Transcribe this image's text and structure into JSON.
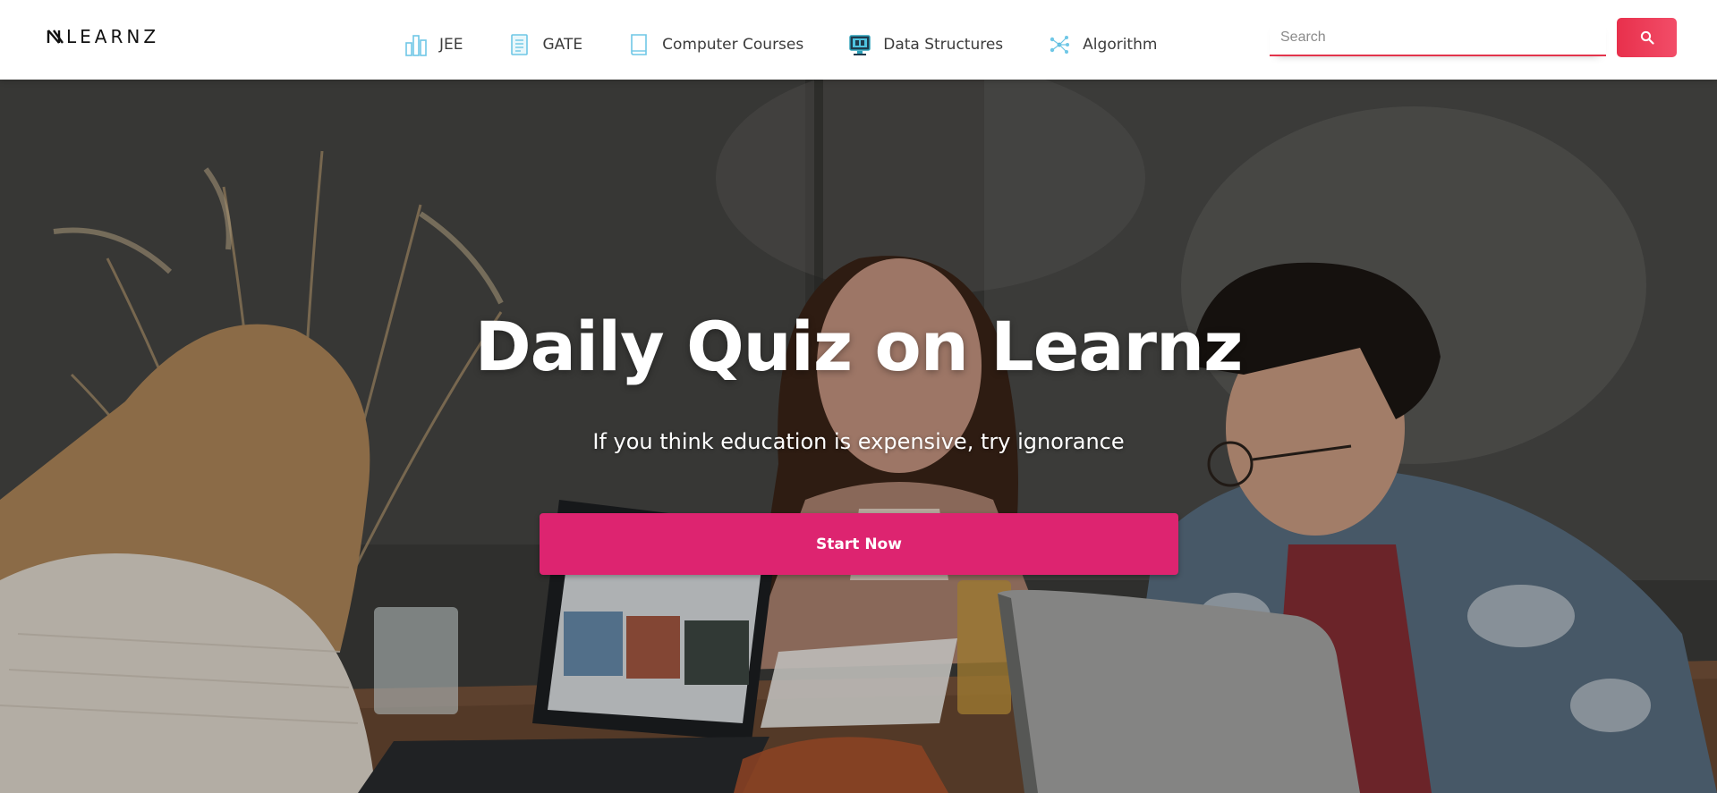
{
  "brand": {
    "name": "LEARNZ",
    "accent": "#dd2470",
    "search_accent": "#e8304c"
  },
  "nav": {
    "items": [
      {
        "label": "JEE",
        "icon": "bar-chart-icon"
      },
      {
        "label": "GATE",
        "icon": "document-icon"
      },
      {
        "label": "Computer Courses",
        "icon": "book-icon"
      },
      {
        "label": "Data Structures",
        "icon": "monitor-icon"
      },
      {
        "label": "Algorithm",
        "icon": "network-icon"
      }
    ]
  },
  "search": {
    "placeholder": "Search",
    "value": "",
    "button_icon": "search-icon"
  },
  "hero": {
    "title": "Daily Quiz on Learnz",
    "subtitle": "If you think education is expensive, try ignorance",
    "cta_label": "Start Now"
  }
}
